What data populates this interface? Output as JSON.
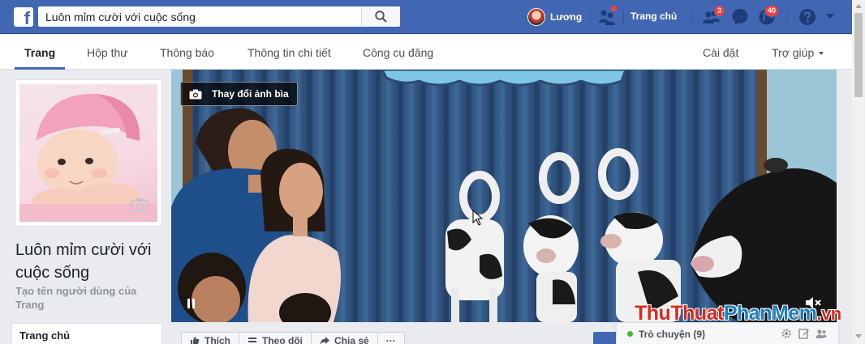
{
  "topbar": {
    "logo": "f",
    "search_value": "Luôn mỉm cười với cuộc sống",
    "user_name": "Lương",
    "home_label": "Trang chủ",
    "friend_requests_badge": "3",
    "notifications_badge": "40"
  },
  "tabs": {
    "items": [
      {
        "label": "Trang"
      },
      {
        "label": "Hộp thư"
      },
      {
        "label": "Thông báo"
      },
      {
        "label": "Thông tin chi tiết"
      },
      {
        "label": "Công cụ đăng"
      }
    ],
    "right": [
      {
        "label": "Cài đặt"
      },
      {
        "label": "Trợ giúp"
      }
    ]
  },
  "page": {
    "name": "Luôn mỉm cười với cuộc sống",
    "create_username": "Tạo tên người dùng của Trang",
    "left_nav_first": "Trang chủ"
  },
  "cover": {
    "change_cover_label": "Thay đổi ảnh bìa"
  },
  "actions": [
    {
      "label": "Thích",
      "icon": "like-icon"
    },
    {
      "label": "Theo dõi",
      "icon": "follow-icon"
    },
    {
      "label": "Chia sẻ",
      "icon": "share-icon"
    },
    {
      "label": "···",
      "icon": "more-icon"
    }
  ],
  "chat": {
    "label": "Trò chuyện (9)"
  },
  "watermark": {
    "part1": "ThuThuat",
    "part2": "PhanMem",
    "part3": ".vn"
  },
  "colors": {
    "brand": "#4267b2",
    "badge": "#fa3e3e",
    "online": "#42b72a"
  }
}
